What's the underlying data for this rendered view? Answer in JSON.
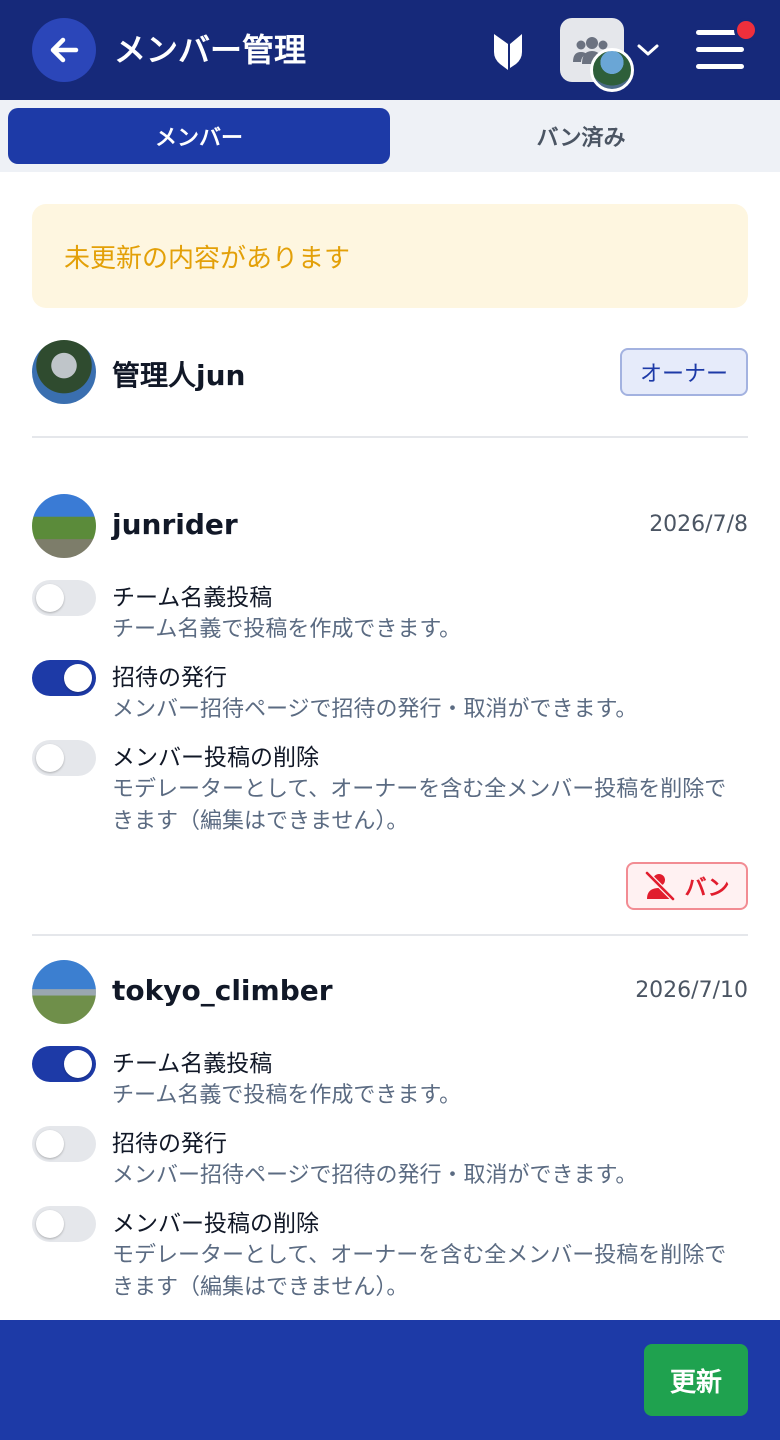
{
  "header": {
    "title": "メンバー管理",
    "icons": [
      "back-arrow-icon",
      "shield-icon",
      "team-icon",
      "chevron-down-icon",
      "menu-icon"
    ]
  },
  "tabs": [
    {
      "label": "メンバー",
      "active": true
    },
    {
      "label": "バン済み",
      "active": false
    }
  ],
  "banner": {
    "text": "未更新の内容があります",
    "color": "#e3a008"
  },
  "owner": {
    "name": "管理人jun",
    "badge": "オーナー"
  },
  "members": [
    {
      "name": "junrider",
      "date": "2026/7/8",
      "permissions": [
        {
          "title": "チーム名義投稿",
          "desc": "チーム名義で投稿を作成できます。",
          "enabled": false
        },
        {
          "title": "招待の発行",
          "desc": "メンバー招待ページで招待の発行・取消ができます。",
          "enabled": true
        },
        {
          "title": "メンバー投稿の削除",
          "desc": "モデレーターとして、オーナーを含む全メンバー投稿を削除できます（編集はできません）。",
          "enabled": false
        }
      ],
      "ban_label": "バン"
    },
    {
      "name": "tokyo_climber",
      "date": "2026/7/10",
      "permissions": [
        {
          "title": "チーム名義投稿",
          "desc": "チーム名義で投稿を作成できます。",
          "enabled": true
        },
        {
          "title": "招待の発行",
          "desc": "メンバー招待ページで招待の発行・取消ができます。",
          "enabled": false
        },
        {
          "title": "メンバー投稿の削除",
          "desc": "モデレーターとして、オーナーを含む全メンバー投稿を削除できます（編集はできません）。",
          "enabled": false
        }
      ]
    }
  ],
  "footer": {
    "update_label": "更新"
  },
  "colors": {
    "header": "#16297a",
    "accent": "#1d3aa7",
    "update": "#1fa24f",
    "ban": "#e11d2e"
  }
}
